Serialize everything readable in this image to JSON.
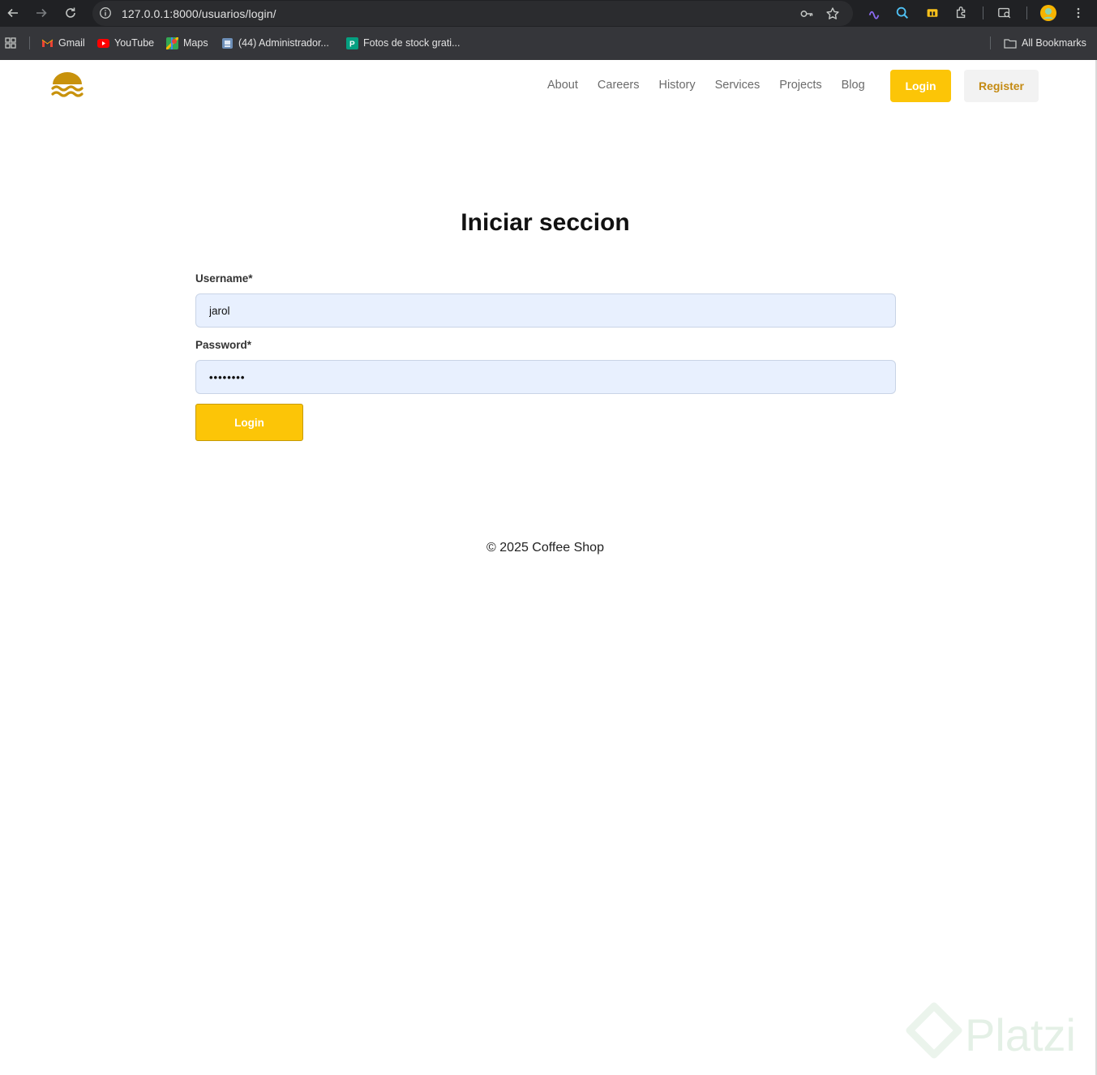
{
  "browser": {
    "url": "127.0.0.1:8000/usuarios/login/",
    "bookmarks": [
      {
        "label": "Gmail",
        "icon": "gmail-icon",
        "color": "#ea4335"
      },
      {
        "label": "YouTube",
        "icon": "youtube-icon",
        "color": "#ff0000"
      },
      {
        "label": "Maps",
        "icon": "maps-icon",
        "color": "#34a853"
      },
      {
        "label": "(44) Administrador...",
        "icon": "admin-icon",
        "color": "#8ab4f8"
      },
      {
        "label": "Fotos de stock grati...",
        "icon": "pexels-icon",
        "color": "#05a081"
      }
    ],
    "all_bookmarks_label": "All Bookmarks"
  },
  "header": {
    "nav": [
      "About",
      "Careers",
      "History",
      "Services",
      "Projects",
      "Blog"
    ],
    "login_label": "Login",
    "register_label": "Register"
  },
  "form": {
    "title": "Iniciar seccion",
    "username_label": "Username*",
    "username_value": "jarol",
    "password_label": "Password*",
    "password_value": "••••••••",
    "submit_label": "Login"
  },
  "footer": {
    "text": "© 2025 Coffee Shop"
  },
  "watermark": {
    "text": "Platzi"
  },
  "colors": {
    "accent": "#fcc507",
    "brand": "#c48a12"
  }
}
